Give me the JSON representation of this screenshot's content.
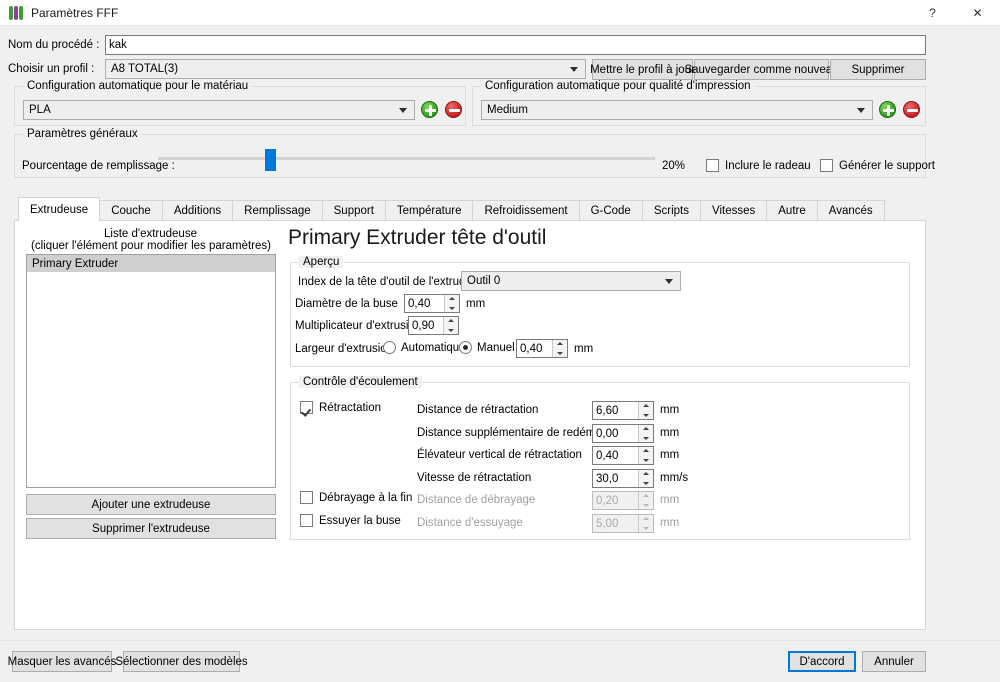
{
  "window": {
    "title": "Paramètres FFF",
    "app_icon": "fff-app-icon",
    "help_label": "?",
    "close_label": "✕"
  },
  "top": {
    "process_name_label": "Nom du procédé :",
    "process_name_value": "kak",
    "process_name_placeholder": "",
    "profile_label": "Choisir un profil :",
    "profile_value": "A8 TOTAL(3)",
    "update_profile_button": "Mettre le profil à jour",
    "save_as_new_button": "Sauvegarder comme nouveau",
    "delete_button": "Supprimer"
  },
  "material_group": {
    "title": "Configuration automatique pour le matériau",
    "value": "PLA",
    "add_label": "+",
    "remove_label": "−"
  },
  "quality_group": {
    "title": "Configuration automatique pour qualité d'impression",
    "value": "Medium",
    "add_label": "+",
    "remove_label": "−"
  },
  "general_group": {
    "title": "Paramètres généraux",
    "infill_label": "Pourcentage de remplissage :",
    "infill_value": "20%",
    "infill_percent": 20,
    "raft_checkbox": {
      "label": "Inclure le radeau",
      "checked": false
    },
    "support_checkbox": {
      "label": "Générer le support",
      "checked": false
    }
  },
  "tabs": [
    {
      "label": "Extrudeuse",
      "active": true
    },
    {
      "label": "Couche",
      "active": false
    },
    {
      "label": "Additions",
      "active": false
    },
    {
      "label": "Remplissage",
      "active": false
    },
    {
      "label": "Support",
      "active": false
    },
    {
      "label": "Température",
      "active": false
    },
    {
      "label": "Refroidissement",
      "active": false
    },
    {
      "label": "G-Code",
      "active": false
    },
    {
      "label": "Scripts",
      "active": false
    },
    {
      "label": "Vitesses",
      "active": false
    },
    {
      "label": "Autre",
      "active": false
    },
    {
      "label": "Avancés",
      "active": false
    }
  ],
  "extruder_list": {
    "title": "Liste d'extrudeuse",
    "subtitle": "(cliquer l'élément pour modifier les paramètres)",
    "items": [
      {
        "label": "Primary Extruder",
        "selected": true
      }
    ],
    "add_button": "Ajouter une extrudeuse",
    "remove_button": "Supprimer l'extrudeuse"
  },
  "extruder_panel": {
    "heading": "Primary Extruder tête d'outil",
    "overview": {
      "title": "Aperçu",
      "toolhead_index_label": "Index de la tête d'outil de l'extrudeuse",
      "toolhead_index_value": "Outil 0",
      "nozzle_diameter_label": "Diamètre de la buse",
      "nozzle_diameter_value": "0,40",
      "nozzle_diameter_unit": "mm",
      "extrusion_multiplier_label": "Multiplicateur d'extrusion",
      "extrusion_multiplier_value": "0,90",
      "extrusion_width_label": "Largeur d'extrusion",
      "extrusion_width_auto": "Automatique",
      "extrusion_width_manual": "Manuel",
      "extrusion_width_mode": "manual",
      "extrusion_width_value": "0,40",
      "extrusion_width_unit": "mm"
    },
    "flow": {
      "title": "Contrôle d'écoulement",
      "retraction_checkbox": {
        "label": "Rétractation",
        "checked": true
      },
      "coast_checkbox": {
        "label": "Débrayage à la fin",
        "checked": false
      },
      "wipe_checkbox": {
        "label": "Essuyer la buse",
        "checked": false
      },
      "rows": [
        {
          "label": "Distance de rétractation",
          "value": "6,60",
          "unit": "mm",
          "disabled": false
        },
        {
          "label": "Distance supplémentaire de redémarrage",
          "value": "0,00",
          "unit": "mm",
          "disabled": false
        },
        {
          "label": "Élévateur vertical de rétractation",
          "value": "0,40",
          "unit": "mm",
          "disabled": false
        },
        {
          "label": "Vitesse de rétractation",
          "value": "30,0",
          "unit": "mm/s",
          "disabled": false
        },
        {
          "label": "Distance de débrayage",
          "value": "0,20",
          "unit": "mm",
          "disabled": true
        },
        {
          "label": "Distance d'essuyage",
          "value": "5,00",
          "unit": "mm",
          "disabled": true
        }
      ]
    }
  },
  "footer": {
    "hide_advanced_button": "Masquer les avancés",
    "select_models_button": "Sélectionner des modèles",
    "ok_button": "D'accord",
    "cancel_button": "Annuler"
  },
  "colors": {
    "accent": "#0078d7",
    "add": "#2e9b23",
    "remove": "#c62222",
    "selection": "#cfcfcf"
  }
}
